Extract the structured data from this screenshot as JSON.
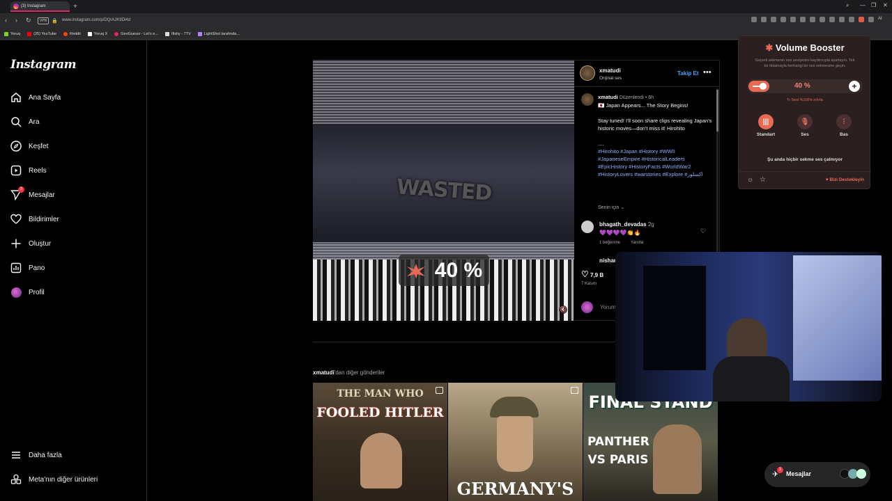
{
  "browser": {
    "tab_title": "(3) Instagram",
    "new_tab": "+",
    "url": "www.instagram.com/p/DQrAJK9Di4d",
    "vpn": "VPN",
    "ai": "AI",
    "bookmarks": [
      {
        "label": "Yoruq",
        "color": "#7ed321"
      },
      {
        "label": "(25) YouTube",
        "color": "#ff0000"
      },
      {
        "label": "Reddit",
        "color": "#ff4500"
      },
      {
        "label": "Yoruq X",
        "color": "#ffffff"
      },
      {
        "label": "GeoGuessr - Let's e...",
        "color": "#e0245e"
      },
      {
        "label": "Ifishy - 7TV",
        "color": "#dddddd"
      },
      {
        "label": "LightShot tarafında...",
        "color": "#b480ff"
      }
    ]
  },
  "sidebar": {
    "logo": "Instagram",
    "items": [
      {
        "label": "Ana Sayfa",
        "icon": "home-icon"
      },
      {
        "label": "Ara",
        "icon": "search-icon"
      },
      {
        "label": "Keşfet",
        "icon": "compass-icon"
      },
      {
        "label": "Reels",
        "icon": "reels-icon"
      },
      {
        "label": "Mesajlar",
        "icon": "messenger-icon",
        "badge": "3"
      },
      {
        "label": "Bildirimler",
        "icon": "heart-icon"
      },
      {
        "label": "Oluştur",
        "icon": "plus-icon"
      },
      {
        "label": "Pano",
        "icon": "dashboard-icon"
      },
      {
        "label": "Profil",
        "icon": "profile-avatar"
      }
    ],
    "bottom": [
      {
        "label": "Daha fazla",
        "icon": "menu-icon"
      },
      {
        "label": "Meta'nın diğer ürünleri",
        "icon": "apps-icon"
      }
    ]
  },
  "video": {
    "overlay_text": "WASTED",
    "volume_pct": "40 %"
  },
  "post": {
    "author": "xmatudi",
    "audio": "Orijinal ses",
    "follow": "Takip Et",
    "more": "•••",
    "caption_author": "xmatudi",
    "caption_meta": "Düzenlendi • 6h",
    "caption_line1": "🇯🇵 Japan Appears... The Story Begins!",
    "caption_line2": "Stay tuned! I'll soon share clips revealing Japan's historic moves—don't miss it! Hirohito",
    "caption_line3": "....",
    "hashtags": "#Hirohito #Japan #History #WWII #JapaneseEmpire #HistoricalLeaders #EpicHistory #HistoryFacts #WorldWar2 #HistoryLovers #warstories #Explore #اکسلور",
    "for_you": "Senin için",
    "comments": [
      {
        "user": "bhagath_devadas",
        "time": "2g",
        "text": "💜💜💜💜👏🔥",
        "likes": "1 beğenme",
        "reply": "Yanıtla"
      },
      {
        "user": "nishan",
        "time": "",
        "text": "",
        "likes": "",
        "reply": ""
      }
    ],
    "like_count": "7,9 B",
    "date": "7 Kasım",
    "comment_placeholder": "Yorum"
  },
  "more_posts": {
    "user": "xmatudi",
    "suffix": "'dan diğer gönderiler",
    "thumbs": [
      {
        "title1": "THE MAN WHO",
        "title2": "FOOLED HITLER",
        "bottom": ""
      },
      {
        "title1": "",
        "title2": "",
        "bottom": "GERMANY'S"
      },
      {
        "title1": "FINAL STAND",
        "title2": "PANTHER VS PARIS",
        "bottom": ""
      }
    ]
  },
  "volume_booster": {
    "title": "Volume Booster",
    "description": "Geçerli sekmenin ses seviyesini kaydırıcıyla ayarlayın. Tek bir tıklamayla herhangi bir ses sekmesine geçin.",
    "percent": "40 %",
    "percent_value": 0.4,
    "reset": "Sesi %100'e sıfırla",
    "modes": [
      "Standart",
      "Ses",
      "Bas"
    ],
    "status": "Şu anda hiçbir sekme ses çalmıyor",
    "support": "Bizi Destekleyin",
    "accent": "#e86a55"
  },
  "messages_pill": {
    "label": "Mesajlar",
    "badge": "3"
  }
}
